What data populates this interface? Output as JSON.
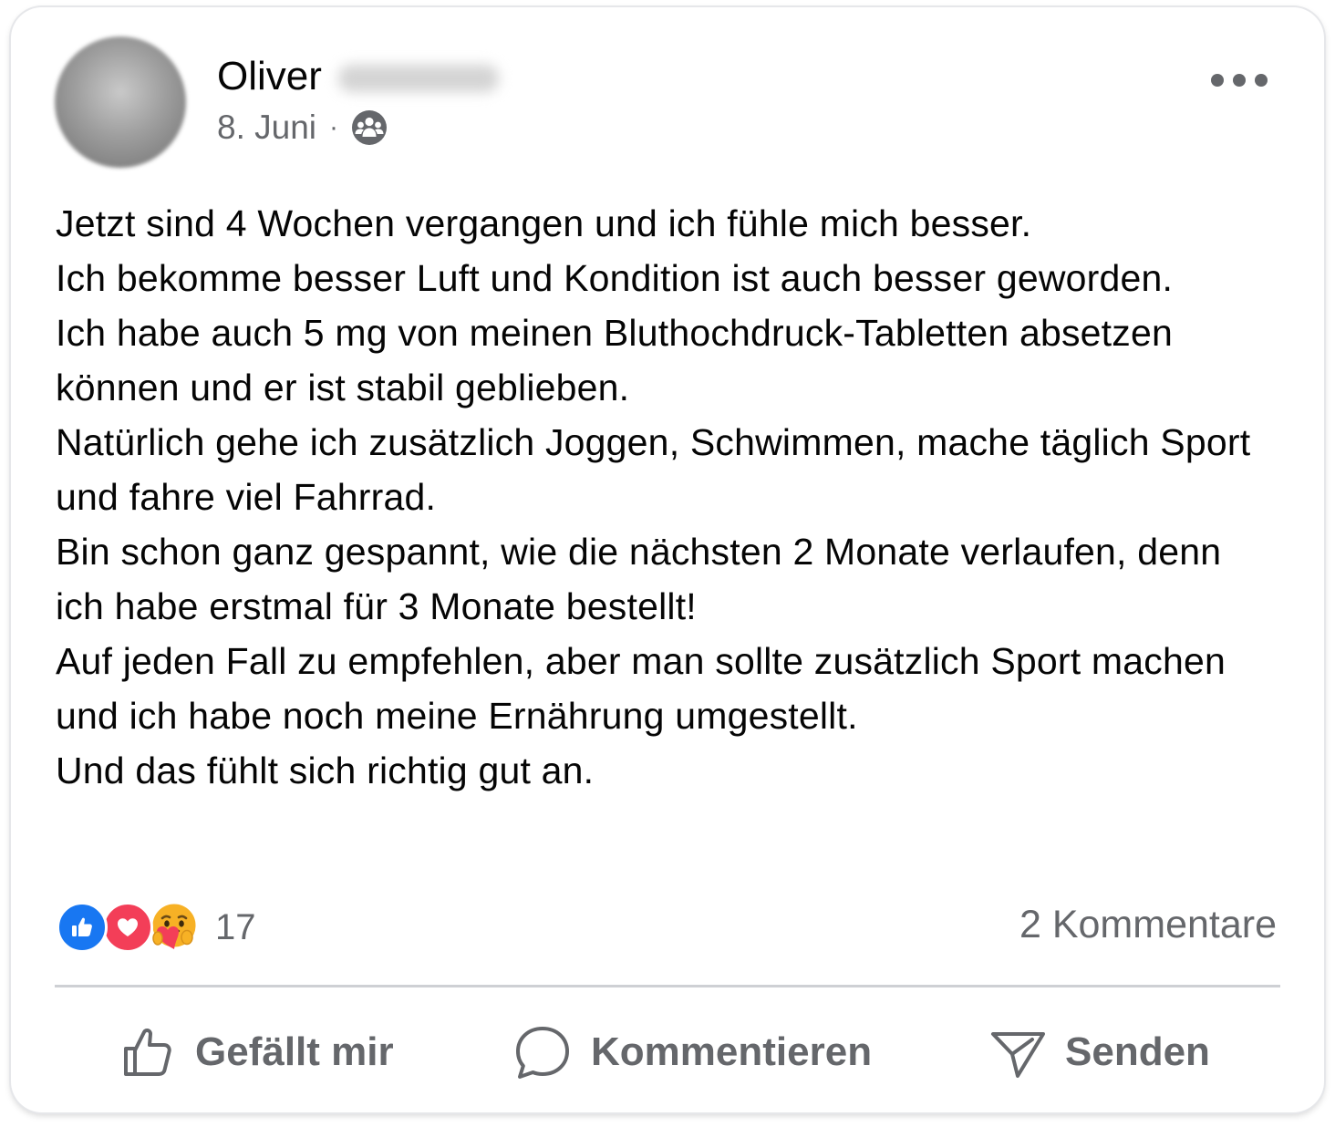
{
  "post": {
    "author": {
      "first_name": "Oliver",
      "avatar_icon": "blurred-profile-photo"
    },
    "date": "8. Juni",
    "separator": "·",
    "audience_icon": "group-audience-icon",
    "more_icon": "more-options-icon",
    "text_lines": [
      "Jetzt sind 4 Wochen vergangen und ich fühle mich besser.",
      "Ich bekomme besser Luft und Kondition ist auch besser geworden.",
      "Ich habe auch 5 mg von meinen Bluthochdruck-Tabletten absetzen können und er ist stabil geblieben.",
      "Natürlich gehe ich zusätzlich Joggen, Schwimmen, mache täglich Sport und fahre viel Fahrrad.",
      "Bin schon ganz gespannt, wie die nächsten 2 Monate verlaufen, denn ich habe erstmal für 3 Monate bestellt!",
      "Auf jeden Fall zu empfehlen, aber man sollte zusätzlich Sport machen und ich habe noch meine Ernährung umgestellt.",
      "Und das fühlt sich richtig gut an."
    ]
  },
  "engagement": {
    "reactions": [
      "like",
      "love",
      "care"
    ],
    "reaction_count": "17",
    "comments_label": "2 Kommentare"
  },
  "actions": {
    "like_label": "Gefällt mir",
    "comment_label": "Kommentieren",
    "send_label": "Senden"
  },
  "colors": {
    "text_primary": "#050505",
    "text_secondary": "#65676b",
    "like_blue": "#1877f2",
    "love_red": "#f33e58",
    "care_yellow": "#f7b125",
    "divider": "#ced0d4"
  }
}
